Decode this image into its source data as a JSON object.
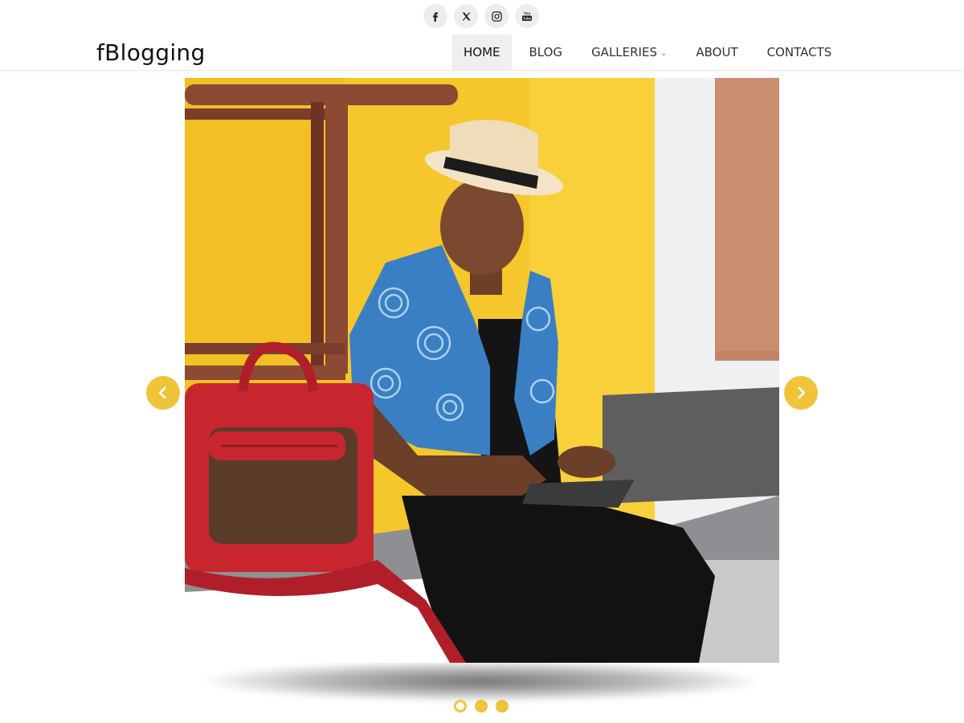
{
  "site": {
    "logo": "fBlogging"
  },
  "social": [
    {
      "name": "facebook-icon"
    },
    {
      "name": "x-icon"
    },
    {
      "name": "instagram-icon"
    },
    {
      "name": "youtube-icon",
      "glyph": "You\nTube"
    }
  ],
  "nav": {
    "items": [
      {
        "label": "HOME",
        "active": true
      },
      {
        "label": "BLOG",
        "active": false
      },
      {
        "label": "GALLERIES",
        "active": false,
        "has_dropdown": true
      },
      {
        "label": "ABOUT",
        "active": false
      },
      {
        "label": "CONTACTS",
        "active": false
      }
    ],
    "caret": "⌄"
  },
  "slider": {
    "slide_count": 3,
    "active_index": 0,
    "prev_icon": "chevron-left-icon",
    "next_icon": "chevron-right-icon"
  },
  "colors": {
    "accent": "#f0c43a",
    "wall_yellow": "#f5c72c",
    "jacket_blue": "#3a7fc4",
    "bag_red": "#c7262f",
    "terracotta": "#c98d6f"
  }
}
